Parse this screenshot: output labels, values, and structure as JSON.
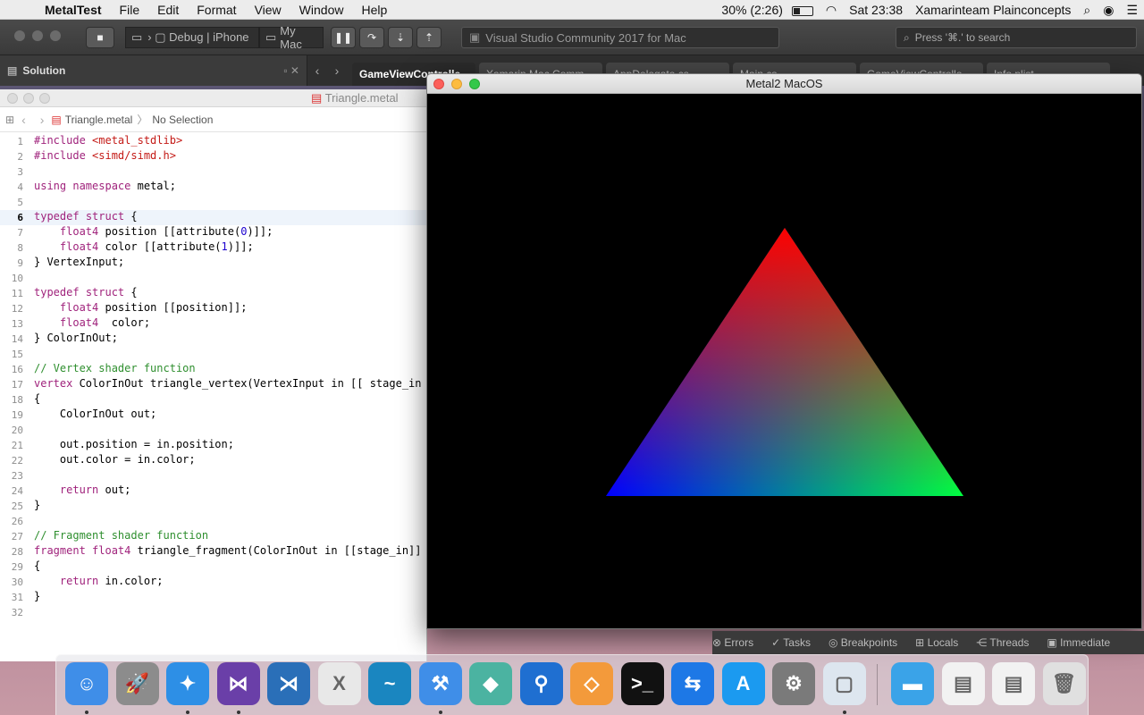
{
  "menubar": {
    "app": "MetalTest",
    "items": [
      "File",
      "Edit",
      "Format",
      "View",
      "Window",
      "Help"
    ],
    "battery": "30% (2:26)",
    "clock": "Sat 23:38",
    "user": "Xamarinteam Plainconcepts"
  },
  "toolbar": {
    "config": "Debug",
    "device": "iPhone",
    "target": "My Mac",
    "status": "Visual Studio Community 2017 for Mac",
    "search_placeholder": "Press '⌘.' to search"
  },
  "pad": {
    "title": "Solution"
  },
  "tabs": [
    "GameViewControlle",
    "Xamarin.Mac.Comm",
    "AppDelegate.cs",
    "Main.cs",
    "GameViewControlle",
    "Info.plist"
  ],
  "editor": {
    "filename": "Triangle.metal",
    "path_file": "Triangle.metal",
    "path_selection": "No Selection",
    "lines": [
      "#include <metal_stdlib>",
      "#include <simd/simd.h>",
      "",
      "using namespace metal;",
      "",
      "typedef struct {",
      "    float4 position [[attribute(0)]];",
      "    float4 color [[attribute(1)]];",
      "} VertexInput;",
      "",
      "typedef struct {",
      "    float4 position [[position]];",
      "    float4  color;",
      "} ColorInOut;",
      "",
      "// Vertex shader function",
      "vertex ColorInOut triangle_vertex(VertexInput in [[ stage_in",
      "{",
      "    ColorInOut out;",
      "",
      "    out.position = in.position;",
      "    out.color = in.color;",
      "",
      "    return out;",
      "}",
      "",
      "// Fragment shader function",
      "fragment float4 triangle_fragment(ColorInOut in [[stage_in]]",
      "{",
      "    return in.color;",
      "}",
      ""
    ]
  },
  "metal_window": {
    "title": "Metal2 MacOS"
  },
  "padbar": [
    "Errors",
    "Tasks",
    "Breakpoints",
    "Locals",
    "Threads",
    "Immediate"
  ],
  "dock": [
    {
      "name": "finder",
      "color": "#3f8ee8"
    },
    {
      "name": "launchpad",
      "color": "#8c8c8c"
    },
    {
      "name": "safari",
      "color": "#2d8fe6"
    },
    {
      "name": "visual-studio",
      "color": "#6a3fa8"
    },
    {
      "name": "vs-code",
      "color": "#2a6fb8"
    },
    {
      "name": "xamarin",
      "color": "#e8e8e8"
    },
    {
      "name": "app-wave",
      "color": "#1a86c0"
    },
    {
      "name": "xcode",
      "color": "#3f8ee8"
    },
    {
      "name": "app-design",
      "color": "#4bb3a1"
    },
    {
      "name": "sourcetree",
      "color": "#1f6fd1"
    },
    {
      "name": "zeplin",
      "color": "#f39a3b"
    },
    {
      "name": "terminal",
      "color": "#111111"
    },
    {
      "name": "teamviewer",
      "color": "#1d78e6"
    },
    {
      "name": "app-store",
      "color": "#1b9af0"
    },
    {
      "name": "system-preferences",
      "color": "#7a7a7a"
    },
    {
      "name": "preview",
      "color": "#dde6ef"
    },
    {
      "name": "folder",
      "color": "#3aa3e8"
    },
    {
      "name": "screenshots",
      "color": "#f2f2f2"
    },
    {
      "name": "documents",
      "color": "#f2f2f2"
    },
    {
      "name": "trash",
      "color": "#e0e0e0"
    }
  ]
}
